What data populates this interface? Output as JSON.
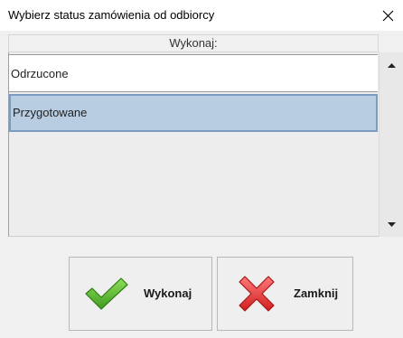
{
  "window": {
    "title": "Wybierz status zamówienia od odbiorcy"
  },
  "list": {
    "header": "Wykonaj:",
    "items": [
      {
        "label": "Odrzucone",
        "selected": false
      },
      {
        "label": "Przygotowane",
        "selected": true
      }
    ]
  },
  "buttons": {
    "execute_label": "Wykonaj",
    "close_label": "Zamknij"
  },
  "icons": {
    "execute": "check-icon",
    "close": "x-icon",
    "window_close": "close-icon"
  },
  "colors": {
    "selection_fill": "#b8cde2",
    "selection_border": "#7d9ac0",
    "check_green": "#5cb82e",
    "cross_red": "#e23a3a"
  }
}
